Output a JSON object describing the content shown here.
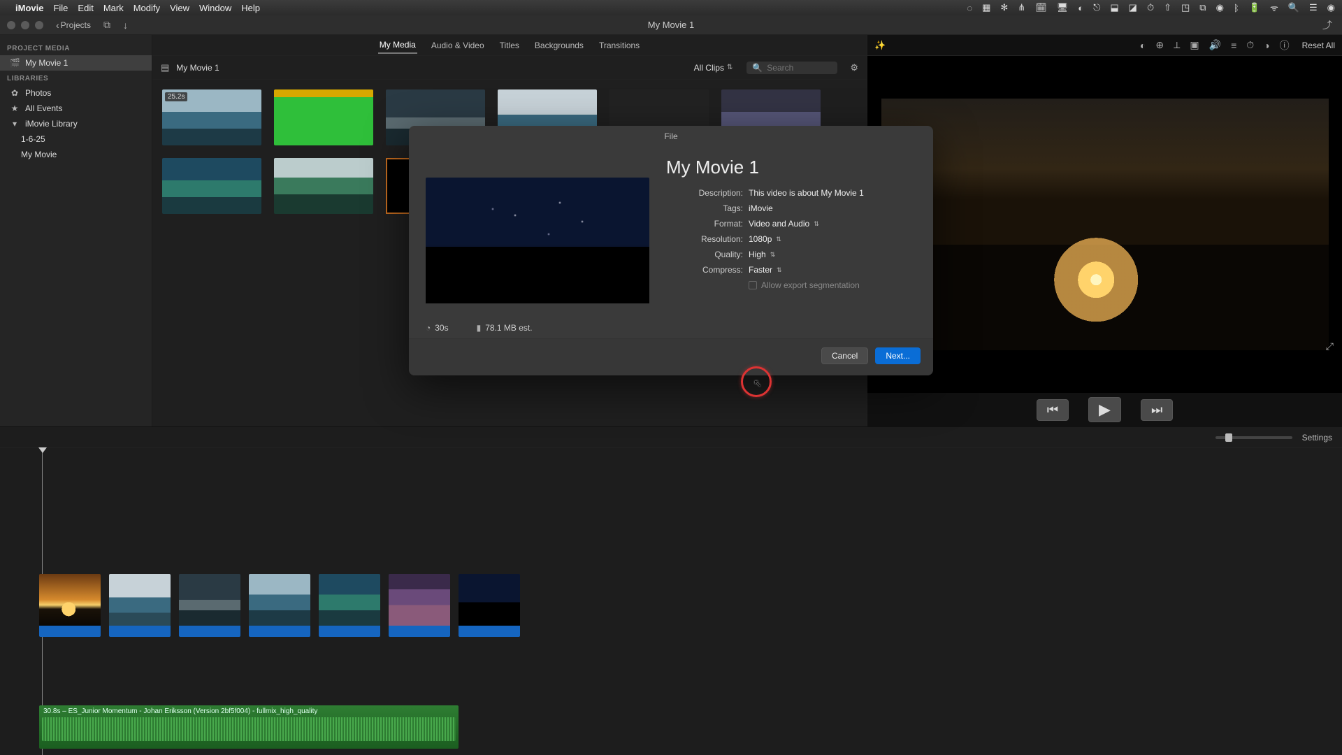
{
  "menubar": {
    "app": "iMovie",
    "items": [
      "File",
      "Edit",
      "Mark",
      "Modify",
      "View",
      "Window",
      "Help"
    ]
  },
  "window": {
    "back_label": "Projects",
    "title": "My Movie 1"
  },
  "tabs": [
    "My Media",
    "Audio & Video",
    "Titles",
    "Backgrounds",
    "Transitions"
  ],
  "active_tab": "My Media",
  "sidebar": {
    "project_media_hd": "PROJECT MEDIA",
    "project_media_item": "My Movie 1",
    "libraries_hd": "LIBRARIES",
    "photos": "Photos",
    "all_events": "All Events",
    "library": "iMovie Library",
    "sub1": "1-6-25",
    "sub2": "My Movie"
  },
  "browser": {
    "breadcrumb": "My Movie 1",
    "clip_filter": "All Clips",
    "search_placeholder": "Search",
    "clip1_duration": "25.2s"
  },
  "viewer": {
    "reset_all": "Reset All"
  },
  "timeline": {
    "settings": "Settings",
    "audio_label": "30.8s – ES_Junior Momentum - Johan Eriksson (Version 2bf5f004) - fullmix_high_quality"
  },
  "modal": {
    "title_bar": "File",
    "heading": "My Movie 1",
    "labels": {
      "description": "Description:",
      "tags": "Tags:",
      "format": "Format:",
      "resolution": "Resolution:",
      "quality": "Quality:",
      "compress": "Compress:"
    },
    "values": {
      "description": "This video is about My Movie 1",
      "tags": "iMovie",
      "format": "Video and Audio",
      "resolution": "1080p",
      "quality": "High",
      "compress": "Faster"
    },
    "segmentation": "Allow export segmentation",
    "duration": "30s",
    "size": "78.1 MB est.",
    "cancel": "Cancel",
    "next": "Next..."
  }
}
